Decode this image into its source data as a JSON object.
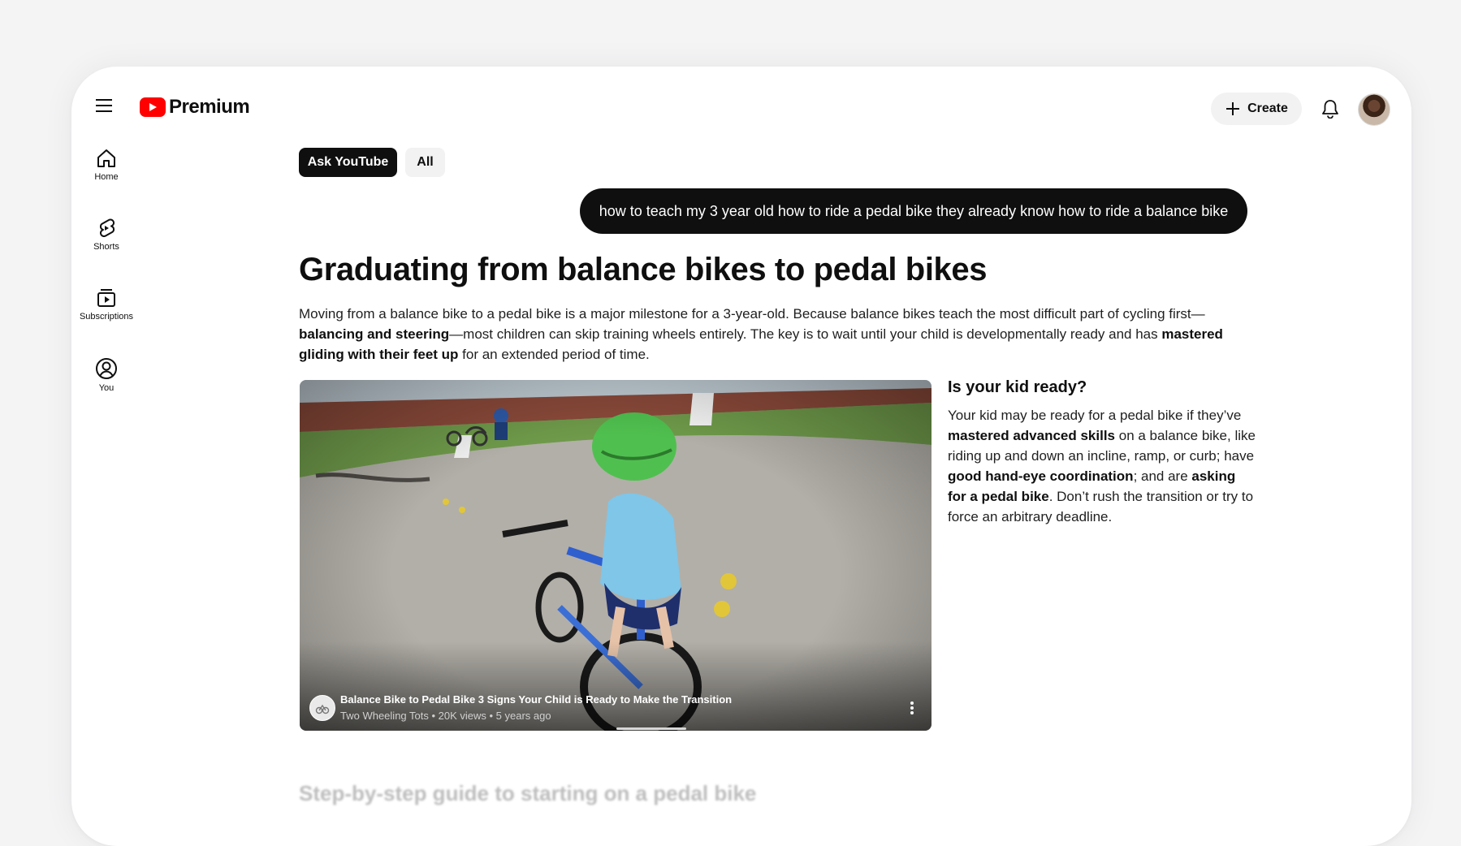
{
  "app": {
    "brand": "Premium",
    "create_label": "Create"
  },
  "sidebar": {
    "items": [
      {
        "label": "Home",
        "icon": "home-icon"
      },
      {
        "label": "Shorts",
        "icon": "shorts-icon"
      },
      {
        "label": "Subscriptions",
        "icon": "subscriptions-icon"
      },
      {
        "label": "You",
        "icon": "you-icon"
      }
    ]
  },
  "filters": {
    "chips": [
      {
        "label": "Ask YouTube",
        "selected": true
      },
      {
        "label": "All",
        "selected": false
      }
    ]
  },
  "query": "how to teach my 3 year old how to ride a pedal bike they already know how to ride a balance bike",
  "answer": {
    "title": "Graduating from balance bikes to pedal bikes",
    "intro": {
      "p1": "Moving from a balance bike to a pedal bike is a major milestone for a 3-year-old. Because balance bikes teach the most difficult part of cycling first—",
      "b1": "balancing and steering",
      "p2": "—most children can skip training wheels entirely. The key is to wait until your child is developmentally ready and has ",
      "b2": "mastered gliding with their feet up",
      "p3": " for an extended period of time."
    },
    "video": {
      "title": "Balance Bike to Pedal Bike 3 Signs Your Child is Ready to Make the Transition",
      "meta": "Two Wheeling Tots • 20K views • 5 years ago"
    },
    "readiness": {
      "heading": "Is your kid ready?",
      "t1": "Your kid may be ready for a pedal bike if they’ve ",
      "b1": "mastered advanced skills",
      "t2": " on a balance bike, like riding up and down an incline, ramp, or curb; have ",
      "b2": "good hand-eye coordination",
      "t3": "; and are ",
      "b3": "asking for a pedal bike",
      "t4": ". Don’t rush the transition or try to force an arbitrary deadline."
    },
    "next_section": "Step-by-step guide to starting on a pedal bike"
  },
  "colors": {
    "brand_red": "#ff0000",
    "chip_selected": "#0f0f0f",
    "chip_default": "#f2f2f2"
  }
}
